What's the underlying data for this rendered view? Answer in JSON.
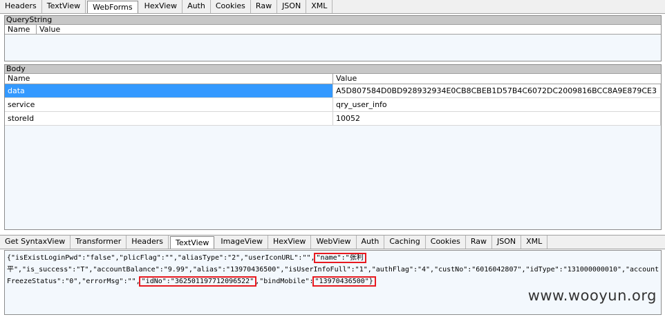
{
  "request_tabs": [
    "Headers",
    "TextView",
    "WebForms",
    "HexView",
    "Auth",
    "Cookies",
    "Raw",
    "JSON",
    "XML"
  ],
  "request_active": 2,
  "querystring": {
    "title": "QueryString",
    "col_name": "Name",
    "col_value": "Value"
  },
  "body": {
    "title": "Body",
    "col_name": "Name",
    "col_value": "Value",
    "rows": [
      {
        "name": "data",
        "value": "A5D807584D0BD928932934E0CB8CBEB1D57B4C6072DC2009816BCC8A9E879CE3"
      },
      {
        "name": "service",
        "value": "qry_user_info"
      },
      {
        "name": "storeId",
        "value": "10052"
      }
    ]
  },
  "response_tabs": [
    "Get SyntaxView",
    "Transformer",
    "Headers",
    "TextView",
    "ImageView",
    "HexView",
    "WebView",
    "Auth",
    "Caching",
    "Cookies",
    "Raw",
    "JSON",
    "XML"
  ],
  "response_active": 3,
  "response_text": {
    "l1a": "{\"isExistLoginPwd\":\"false\",\"plicFlag\":\"\",\"aliasType\":\"2\",\"userIconURL\":\"\",",
    "l1b": "\"name\":\"张利",
    "l2": "平\",\"is_success\":\"T\",\"accountBalance\":\"9.99\",\"alias\":\"13970436500\",\"isUserInfoFull\":\"1\",\"authFlag\":\"4\",\"custNo\":\"6016042807\",\"idType\":\"131000000010\",\"account",
    "l3a": "FreezeStatus\":\"0\",\"errorMsg\":\"\",",
    "l3b": "\"idNo\":\"362501197712096522\"",
    "l3c": ",\"bindMobile\":",
    "l3d": "\"13970436500\"}"
  },
  "watermark": "www.wooyun.org"
}
